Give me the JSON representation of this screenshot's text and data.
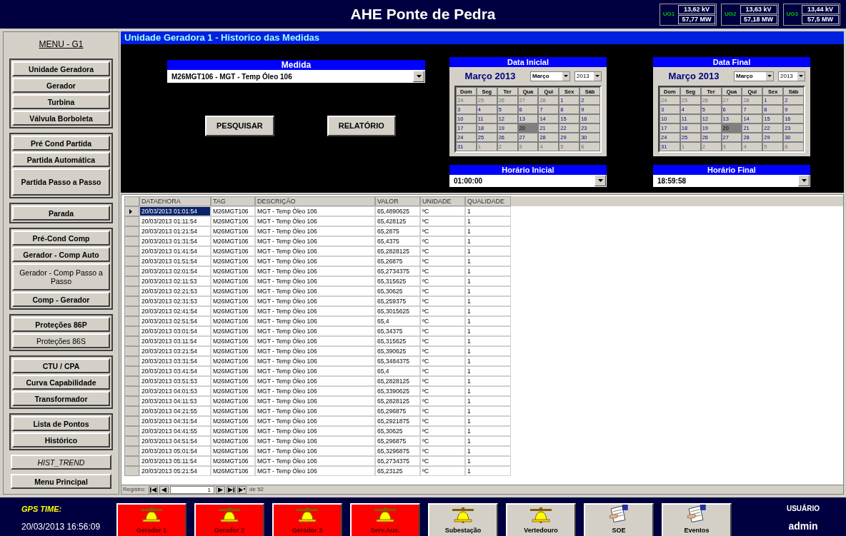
{
  "header": {
    "title": "AHE Ponte de Pedra",
    "units": [
      {
        "label": "UG1",
        "voltage": "13,62 kV",
        "power": "57,77 MW"
      },
      {
        "label": "UG2",
        "voltage": "13,63 kV",
        "power": "57,18 MW"
      },
      {
        "label": "UG3",
        "voltage": "13,44 kV",
        "power": "57,5 MW"
      }
    ]
  },
  "menu": {
    "title": "MENU - G1",
    "groups": [
      {
        "framed": true,
        "items": [
          {
            "label": "Unidade Geradora",
            "kind": "bold",
            "tall": false
          },
          {
            "label": "Gerador",
            "kind": "bold",
            "tall": false
          },
          {
            "label": "Turbina",
            "kind": "bold",
            "tall": false
          },
          {
            "label": "Válvula Borboleta",
            "kind": "bold",
            "tall": false
          }
        ]
      },
      {
        "framed": true,
        "items": [
          {
            "label": "Pré Cond Partida",
            "kind": "bold",
            "tall": false
          },
          {
            "label": "Partida Automática",
            "kind": "bold",
            "tall": false
          },
          {
            "label": "Partida Passo a Passo",
            "kind": "bold",
            "tall": true
          }
        ]
      },
      {
        "framed": true,
        "items": [
          {
            "label": "Parada",
            "kind": "bold",
            "tall": false
          }
        ]
      },
      {
        "framed": true,
        "items": [
          {
            "label": "Pré-Cond Comp",
            "kind": "bold",
            "tall": false
          },
          {
            "label": "Gerador - Comp Auto",
            "kind": "bold",
            "tall": false
          },
          {
            "label": "Gerador - Comp Passo a Passo",
            "kind": "plain",
            "tall": true
          },
          {
            "label": "Comp - Gerador",
            "kind": "bold",
            "tall": false
          }
        ]
      },
      {
        "framed": true,
        "items": [
          {
            "label": "Proteções 86P",
            "kind": "bold",
            "tall": false
          },
          {
            "label": "Proteções 86S",
            "kind": "plain",
            "tall": false
          }
        ]
      },
      {
        "framed": true,
        "items": [
          {
            "label": "CTU / CPA",
            "kind": "bold",
            "tall": false
          },
          {
            "label": "Curva Capabilidade",
            "kind": "bold",
            "tall": false
          },
          {
            "label": "Transformador",
            "kind": "bold",
            "tall": false
          }
        ]
      },
      {
        "framed": true,
        "items": [
          {
            "label": "Lista de Pontos",
            "kind": "bold",
            "tall": false
          },
          {
            "label": "Histórico",
            "kind": "bold",
            "tall": false
          }
        ]
      },
      {
        "framed": false,
        "items": [
          {
            "label": "HIST_TREND",
            "kind": "italic",
            "tall": false
          }
        ]
      },
      {
        "framed": false,
        "items": [
          {
            "label": "Menu Principal",
            "kind": "bold",
            "tall": false
          }
        ]
      }
    ]
  },
  "page_title": "Unidade Geradora 1 - Historico das Medidas",
  "measure": {
    "label": "Medida",
    "value": "M26MGT106 - MGT - Temp Óleo 106"
  },
  "buttons": [
    "PESQUISAR",
    "RELATÓRIO"
  ],
  "calendars": [
    {
      "label": "Data Inicial",
      "month_title": "Março 2013",
      "month": "Março",
      "year": "2013",
      "weekdays": [
        "Dom",
        "Seg",
        "Ter",
        "Qua",
        "Qui",
        "Sex",
        "Sáb"
      ],
      "days": [
        {
          "day": "24",
          "muted": true,
          "selected": false
        },
        {
          "day": "25",
          "muted": true,
          "selected": false
        },
        {
          "day": "26",
          "muted": true,
          "selected": false
        },
        {
          "day": "27",
          "muted": true,
          "selected": false
        },
        {
          "day": "28",
          "muted": true,
          "selected": false
        },
        {
          "day": "1",
          "muted": false,
          "selected": false
        },
        {
          "day": "2",
          "muted": false,
          "selected": false
        },
        {
          "day": "3",
          "muted": false,
          "selected": false
        },
        {
          "day": "4",
          "muted": false,
          "selected": false
        },
        {
          "day": "5",
          "muted": false,
          "selected": false
        },
        {
          "day": "6",
          "muted": false,
          "selected": false
        },
        {
          "day": "7",
          "muted": false,
          "selected": false
        },
        {
          "day": "8",
          "muted": false,
          "selected": false
        },
        {
          "day": "9",
          "muted": false,
          "selected": false
        },
        {
          "day": "10",
          "muted": false,
          "selected": false
        },
        {
          "day": "11",
          "muted": false,
          "selected": false
        },
        {
          "day": "12",
          "muted": false,
          "selected": false
        },
        {
          "day": "13",
          "muted": false,
          "selected": false
        },
        {
          "day": "14",
          "muted": false,
          "selected": false
        },
        {
          "day": "15",
          "muted": false,
          "selected": false
        },
        {
          "day": "16",
          "muted": false,
          "selected": false
        },
        {
          "day": "17",
          "muted": false,
          "selected": false
        },
        {
          "day": "18",
          "muted": false,
          "selected": false
        },
        {
          "day": "19",
          "muted": false,
          "selected": false
        },
        {
          "day": "20",
          "muted": false,
          "selected": true
        },
        {
          "day": "21",
          "muted": false,
          "selected": false
        },
        {
          "day": "22",
          "muted": false,
          "selected": false
        },
        {
          "day": "23",
          "muted": false,
          "selected": false
        },
        {
          "day": "24",
          "muted": false,
          "selected": false
        },
        {
          "day": "25",
          "muted": false,
          "selected": false
        },
        {
          "day": "26",
          "muted": false,
          "selected": false
        },
        {
          "day": "27",
          "muted": false,
          "selected": false
        },
        {
          "day": "28",
          "muted": false,
          "selected": false
        },
        {
          "day": "29",
          "muted": false,
          "selected": false
        },
        {
          "day": "30",
          "muted": false,
          "selected": false
        },
        {
          "day": "31",
          "muted": false,
          "selected": false
        },
        {
          "day": "1",
          "muted": true,
          "selected": false
        },
        {
          "day": "2",
          "muted": true,
          "selected": false
        },
        {
          "day": "3",
          "muted": true,
          "selected": false
        },
        {
          "day": "4",
          "muted": true,
          "selected": false
        },
        {
          "day": "5",
          "muted": true,
          "selected": false
        },
        {
          "day": "6",
          "muted": true,
          "selected": false
        }
      ]
    },
    {
      "label": "Data Final",
      "month_title": "Março 2013",
      "month": "Março",
      "year": "2013",
      "weekdays": [
        "Dom",
        "Seg",
        "Ter",
        "Qua",
        "Qui",
        "Sex",
        "Sáb"
      ],
      "days": [
        {
          "day": "24",
          "muted": true,
          "selected": false
        },
        {
          "day": "25",
          "muted": true,
          "selected": false
        },
        {
          "day": "26",
          "muted": true,
          "selected": false
        },
        {
          "day": "27",
          "muted": true,
          "selected": false
        },
        {
          "day": "28",
          "muted": true,
          "selected": false
        },
        {
          "day": "1",
          "muted": false,
          "selected": false
        },
        {
          "day": "2",
          "muted": false,
          "selected": false
        },
        {
          "day": "3",
          "muted": false,
          "selected": false
        },
        {
          "day": "4",
          "muted": false,
          "selected": false
        },
        {
          "day": "5",
          "muted": false,
          "selected": false
        },
        {
          "day": "6",
          "muted": false,
          "selected": false
        },
        {
          "day": "7",
          "muted": false,
          "selected": false
        },
        {
          "day": "8",
          "muted": false,
          "selected": false
        },
        {
          "day": "9",
          "muted": false,
          "selected": false
        },
        {
          "day": "10",
          "muted": false,
          "selected": false
        },
        {
          "day": "11",
          "muted": false,
          "selected": false
        },
        {
          "day": "12",
          "muted": false,
          "selected": false
        },
        {
          "day": "13",
          "muted": false,
          "selected": false
        },
        {
          "day": "14",
          "muted": false,
          "selected": false
        },
        {
          "day": "15",
          "muted": false,
          "selected": false
        },
        {
          "day": "16",
          "muted": false,
          "selected": false
        },
        {
          "day": "17",
          "muted": false,
          "selected": false
        },
        {
          "day": "18",
          "muted": false,
          "selected": false
        },
        {
          "day": "19",
          "muted": false,
          "selected": false
        },
        {
          "day": "20",
          "muted": false,
          "selected": true
        },
        {
          "day": "21",
          "muted": false,
          "selected": false
        },
        {
          "day": "22",
          "muted": false,
          "selected": false
        },
        {
          "day": "23",
          "muted": false,
          "selected": false
        },
        {
          "day": "24",
          "muted": false,
          "selected": false
        },
        {
          "day": "25",
          "muted": false,
          "selected": false
        },
        {
          "day": "26",
          "muted": false,
          "selected": false
        },
        {
          "day": "27",
          "muted": false,
          "selected": false
        },
        {
          "day": "28",
          "muted": false,
          "selected": false
        },
        {
          "day": "29",
          "muted": false,
          "selected": false
        },
        {
          "day": "30",
          "muted": false,
          "selected": false
        },
        {
          "day": "31",
          "muted": false,
          "selected": false
        },
        {
          "day": "1",
          "muted": true,
          "selected": false
        },
        {
          "day": "2",
          "muted": true,
          "selected": false
        },
        {
          "day": "3",
          "muted": true,
          "selected": false
        },
        {
          "day": "4",
          "muted": true,
          "selected": false
        },
        {
          "day": "5",
          "muted": true,
          "selected": false
        },
        {
          "day": "6",
          "muted": true,
          "selected": false
        }
      ]
    }
  ],
  "times": [
    {
      "label": "Horário Inicial",
      "value": "01:00:00"
    },
    {
      "label": "Horário Final",
      "value": "18:59:58"
    }
  ],
  "table": {
    "columns": [
      "DATAEHORA",
      "TAG",
      "DESCRIÇÃO",
      "VALOR",
      "UNIDADE",
      "QUALIDADE"
    ],
    "rows": [
      {
        "selected": true,
        "cells": [
          "20/03/2013 01:01:54",
          "M26MGT106",
          "MGT - Temp Óleo 106",
          "65,4890625",
          "ºC",
          "1"
        ]
      },
      {
        "selected": false,
        "cells": [
          "20/03/2013 01:11:54",
          "M26MGT106",
          "MGT - Temp Óleo 106",
          "65,428125",
          "ºC",
          "1"
        ]
      },
      {
        "selected": false,
        "cells": [
          "20/03/2013 01:21:54",
          "M26MGT106",
          "MGT - Temp Óleo 106",
          "65,2875",
          "ºC",
          "1"
        ]
      },
      {
        "selected": false,
        "cells": [
          "20/03/2013 01:31:54",
          "M26MGT106",
          "MGT - Temp Óleo 106",
          "65,4375",
          "ºC",
          "1"
        ]
      },
      {
        "selected": false,
        "cells": [
          "20/03/2013 01:41:54",
          "M26MGT106",
          "MGT - Temp Óleo 106",
          "65,2828125",
          "ºC",
          "1"
        ]
      },
      {
        "selected": false,
        "cells": [
          "20/03/2013 01:51:54",
          "M26MGT106",
          "MGT - Temp Óleo 106",
          "65,26875",
          "ºC",
          "1"
        ]
      },
      {
        "selected": false,
        "cells": [
          "20/03/2013 02:01:54",
          "M26MGT106",
          "MGT - Temp Óleo 106",
          "65,2734375",
          "ºC",
          "1"
        ]
      },
      {
        "selected": false,
        "cells": [
          "20/03/2013 02:11:53",
          "M26MGT106",
          "MGT - Temp Óleo 106",
          "65,315625",
          "ºC",
          "1"
        ]
      },
      {
        "selected": false,
        "cells": [
          "20/03/2013 02:21:53",
          "M26MGT106",
          "MGT - Temp Óleo 106",
          "65,30625",
          "ºC",
          "1"
        ]
      },
      {
        "selected": false,
        "cells": [
          "20/03/2013 02:31:53",
          "M26MGT106",
          "MGT - Temp Óleo 106",
          "65,259375",
          "ºC",
          "1"
        ]
      },
      {
        "selected": false,
        "cells": [
          "20/03/2013 02:41:54",
          "M26MGT106",
          "MGT - Temp Óleo 106",
          "65,3015625",
          "ºC",
          "1"
        ]
      },
      {
        "selected": false,
        "cells": [
          "20/03/2013 02:51:54",
          "M26MGT106",
          "MGT - Temp Óleo 106",
          "65,4",
          "ºC",
          "1"
        ]
      },
      {
        "selected": false,
        "cells": [
          "20/03/2013 03:01:54",
          "M26MGT106",
          "MGT - Temp Óleo 106",
          "65,34375",
          "ºC",
          "1"
        ]
      },
      {
        "selected": false,
        "cells": [
          "20/03/2013 03:11:54",
          "M26MGT106",
          "MGT - Temp Óleo 106",
          "65,315625",
          "ºC",
          "1"
        ]
      },
      {
        "selected": false,
        "cells": [
          "20/03/2013 03:21:54",
          "M26MGT106",
          "MGT - Temp Óleo 106",
          "65,390625",
          "ºC",
          "1"
        ]
      },
      {
        "selected": false,
        "cells": [
          "20/03/2013 03:31:54",
          "M26MGT106",
          "MGT - Temp Óleo 106",
          "65,3484375",
          "ºC",
          "1"
        ]
      },
      {
        "selected": false,
        "cells": [
          "20/03/2013 03:41:54",
          "M26MGT106",
          "MGT - Temp Óleo 106",
          "65,4",
          "ºC",
          "1"
        ]
      },
      {
        "selected": false,
        "cells": [
          "20/03/2013 03:51:53",
          "M26MGT106",
          "MGT - Temp Óleo 106",
          "65,2828125",
          "ºC",
          "1"
        ]
      },
      {
        "selected": false,
        "cells": [
          "20/03/2013 04:01:53",
          "M26MGT106",
          "MGT - Temp Óleo 106",
          "65,3390625",
          "ºC",
          "1"
        ]
      },
      {
        "selected": false,
        "cells": [
          "20/03/2013 04:11:53",
          "M26MGT106",
          "MGT - Temp Óleo 106",
          "65,2828125",
          "ºC",
          "1"
        ]
      },
      {
        "selected": false,
        "cells": [
          "20/03/2013 04:21:55",
          "M26MGT106",
          "MGT - Temp Óleo 106",
          "65,296875",
          "ºC",
          "1"
        ]
      },
      {
        "selected": false,
        "cells": [
          "20/03/2013 04:31:54",
          "M26MGT106",
          "MGT - Temp Óleo 106",
          "65,2921875",
          "ºC",
          "1"
        ]
      },
      {
        "selected": false,
        "cells": [
          "20/03/2013 04:41:55",
          "M26MGT106",
          "MGT - Temp Óleo 106",
          "65,30625",
          "ºC",
          "1"
        ]
      },
      {
        "selected": false,
        "cells": [
          "20/03/2013 04:51:54",
          "M26MGT106",
          "MGT - Temp Óleo 106",
          "65,296875",
          "ºC",
          "1"
        ]
      },
      {
        "selected": false,
        "cells": [
          "20/03/2013 05:01:54",
          "M26MGT106",
          "MGT - Temp Óleo 106",
          "65,3296875",
          "ºC",
          "1"
        ]
      },
      {
        "selected": false,
        "cells": [
          "20/03/2013 05:11:54",
          "M26MGT106",
          "MGT - Temp Óleo 106",
          "65,2734375",
          "ºC",
          "1"
        ]
      },
      {
        "selected": false,
        "cells": [
          "20/03/2013 05:21:54",
          "M26MGT106",
          "MGT - Temp Óleo 106",
          "65,23125",
          "ºC",
          "1"
        ]
      }
    ]
  },
  "navigator": {
    "label": "Registro:",
    "current": "1",
    "total": "de 52"
  },
  "status": {
    "gps_label": "GPS TIME:",
    "gps_time": "20/03/2013 16:56:09",
    "user_label": "USUÁRIO",
    "user": "admin"
  },
  "alarm_buttons": [
    {
      "label": "Gerador 1",
      "kind": "bell",
      "alarm": true
    },
    {
      "label": "Gerador 2",
      "kind": "bell",
      "alarm": true
    },
    {
      "label": "Gerador 3",
      "kind": "bell",
      "alarm": true
    },
    {
      "label": "Serv.Aux.",
      "kind": "bell",
      "alarm": true
    },
    {
      "label": "Subestação",
      "kind": "bell",
      "alarm": false
    },
    {
      "label": "Vertedouro",
      "kind": "bell",
      "alarm": false
    },
    {
      "label": "SOE",
      "kind": "document",
      "alarm": false
    },
    {
      "label": "Eventos",
      "kind": "document",
      "alarm": false
    }
  ]
}
